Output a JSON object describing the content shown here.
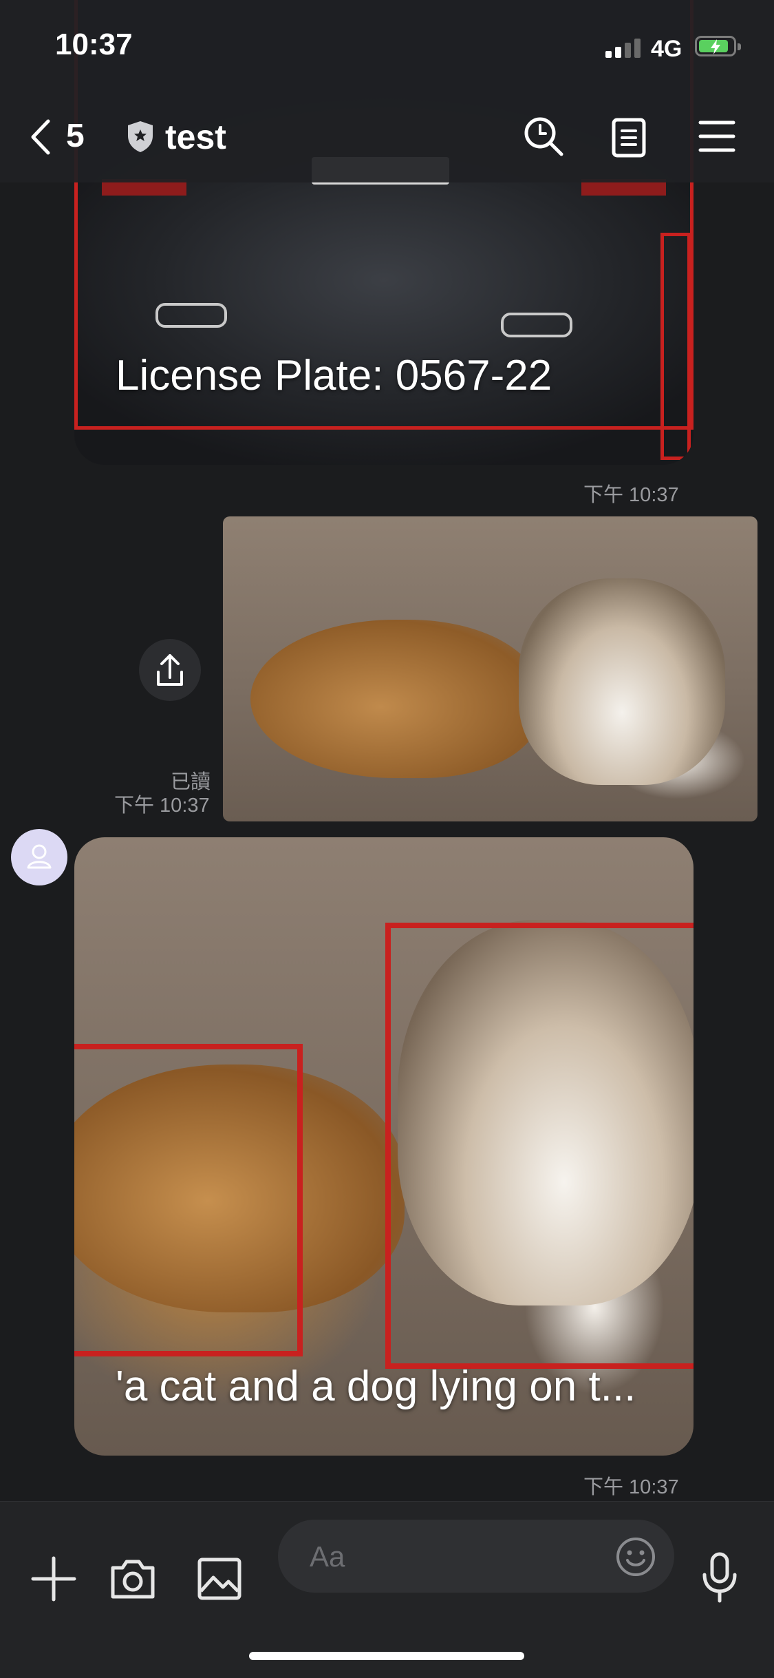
{
  "status_bar": {
    "time": "10:37",
    "network": "4G"
  },
  "header": {
    "back_count": "5",
    "chat_title": "test"
  },
  "messages": [
    {
      "sender": "other",
      "image_desc": "car",
      "caption": "License Plate: 0567-22",
      "timestamp": "下午 10:37"
    },
    {
      "sender": "me",
      "image_desc": "pets",
      "read_label": "已讀",
      "timestamp": "下午 10:37"
    },
    {
      "sender": "other",
      "image_desc": "pets-detected",
      "caption": "'a cat and a dog lying on t...",
      "timestamp": "下午 10:37"
    }
  ],
  "input_bar": {
    "placeholder": "Aa"
  },
  "icons": {
    "back": "chevron-left-icon",
    "shield": "shield-icon",
    "search": "search-icon",
    "notes": "notes-icon",
    "menu": "menu-icon",
    "share": "share-icon",
    "avatar": "person-icon",
    "plus": "plus-icon",
    "camera": "camera-icon",
    "gallery": "image-icon",
    "emoji": "emoji-icon",
    "mic": "microphone-icon"
  },
  "colors": {
    "background": "#1b1c1e",
    "header": "#1f2023",
    "input_bar": "#232426",
    "detection_box": "#c8211f",
    "battery": "#5ad05f",
    "avatar": "#dcd9f4"
  }
}
